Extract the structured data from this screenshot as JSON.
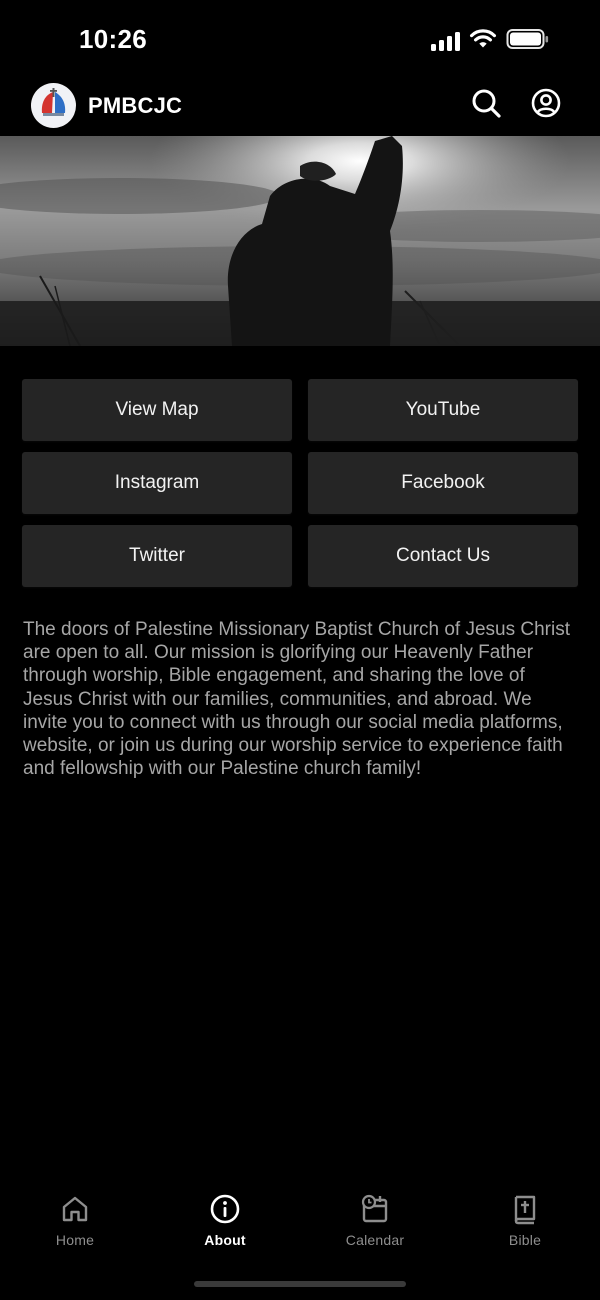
{
  "status_bar": {
    "time": "10:26",
    "icons": [
      "signal-icon",
      "wifi-icon",
      "battery-icon"
    ]
  },
  "header": {
    "title": "PMBCJC",
    "logo_icon": "church-logo-icon",
    "search_icon": "search-icon",
    "profile_icon": "profile-icon"
  },
  "hero": {
    "description": "hero-image"
  },
  "links": [
    {
      "label": "View Map"
    },
    {
      "label": "YouTube"
    },
    {
      "label": "Instagram"
    },
    {
      "label": "Facebook"
    },
    {
      "label": "Twitter"
    },
    {
      "label": "Contact Us"
    }
  ],
  "about_text": "The doors of Palestine Missionary Baptist Church of Jesus Christ are open to all. Our mission is glorifying our Heavenly Father through worship, Bible engagement, and sharing the love of Jesus Christ with our families, communities, and abroad. We invite you to connect with us through our social media platforms, website, or join us during our worship service to experience faith and fellowship with our Palestine church family!",
  "tabs": [
    {
      "label": "Home",
      "icon": "home-icon",
      "active": false
    },
    {
      "label": "About",
      "icon": "info-icon",
      "active": true
    },
    {
      "label": "Calendar",
      "icon": "calendar-icon",
      "active": false
    },
    {
      "label": "Bible",
      "icon": "bible-icon",
      "active": false
    }
  ],
  "colors": {
    "background": "#000000",
    "button_bg": "#252525",
    "body_text": "#a6a6a6",
    "tab_inactive": "#8e8e8e",
    "tab_active": "#ffffff"
  }
}
